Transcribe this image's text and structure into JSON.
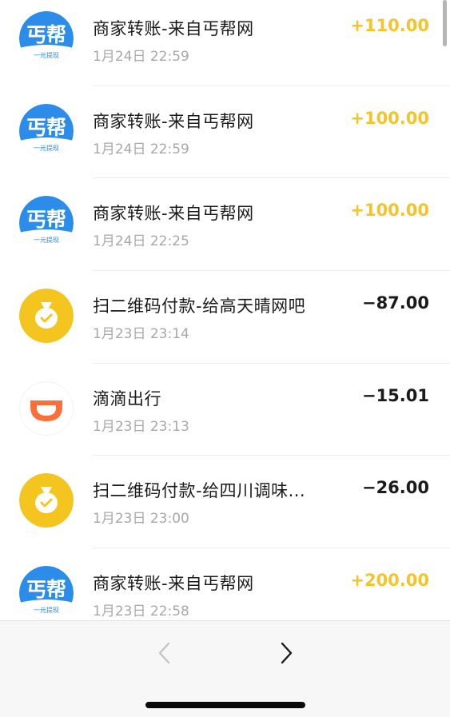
{
  "colors": {
    "income": "#f5c32c",
    "expense": "#1a1a1a",
    "bangbang_blue": "#2b8de9",
    "scan_yellow": "#f4c51f",
    "didi_orange": "#fc6f3a"
  },
  "transactions": [
    {
      "icon": "bangbang-logo-icon",
      "logo_text": "丐帮",
      "logo_sub": "一元提现",
      "title": "商家转账-来自丐帮网",
      "time": "1月24日 22:59",
      "amount": "+110.00",
      "type": "income"
    },
    {
      "icon": "bangbang-logo-icon",
      "logo_text": "丐帮",
      "logo_sub": "一元提现",
      "title": "商家转账-来自丐帮网",
      "time": "1月24日 22:59",
      "amount": "+100.00",
      "type": "income"
    },
    {
      "icon": "bangbang-logo-icon",
      "logo_text": "丐帮",
      "logo_sub": "一元提现",
      "title": "商家转账-来自丐帮网",
      "time": "1月24日 22:25",
      "amount": "+100.00",
      "type": "income"
    },
    {
      "icon": "money-bag-icon",
      "title": "扫二维码付款-给高天晴网吧",
      "time": "1月23日 23:14",
      "amount": "−87.00",
      "type": "expense"
    },
    {
      "icon": "didi-logo-icon",
      "title": "滴滴出行",
      "time": "1月23日 23:13",
      "amount": "−15.01",
      "type": "expense"
    },
    {
      "icon": "money-bag-icon",
      "title": "扫二维码付款-给四川调味...",
      "time": "1月23日 23:00",
      "amount": "−26.00",
      "type": "expense"
    },
    {
      "icon": "bangbang-logo-icon",
      "logo_text": "丐帮",
      "logo_sub": "一元提现",
      "title": "商家转账-来自丐帮网",
      "time": "1月23日 22:58",
      "amount": "+200.00",
      "type": "income"
    }
  ],
  "toolbar": {
    "back_icon": "chevron-left-icon",
    "forward_icon": "chevron-right-icon",
    "back_enabled": false,
    "forward_enabled": true
  }
}
